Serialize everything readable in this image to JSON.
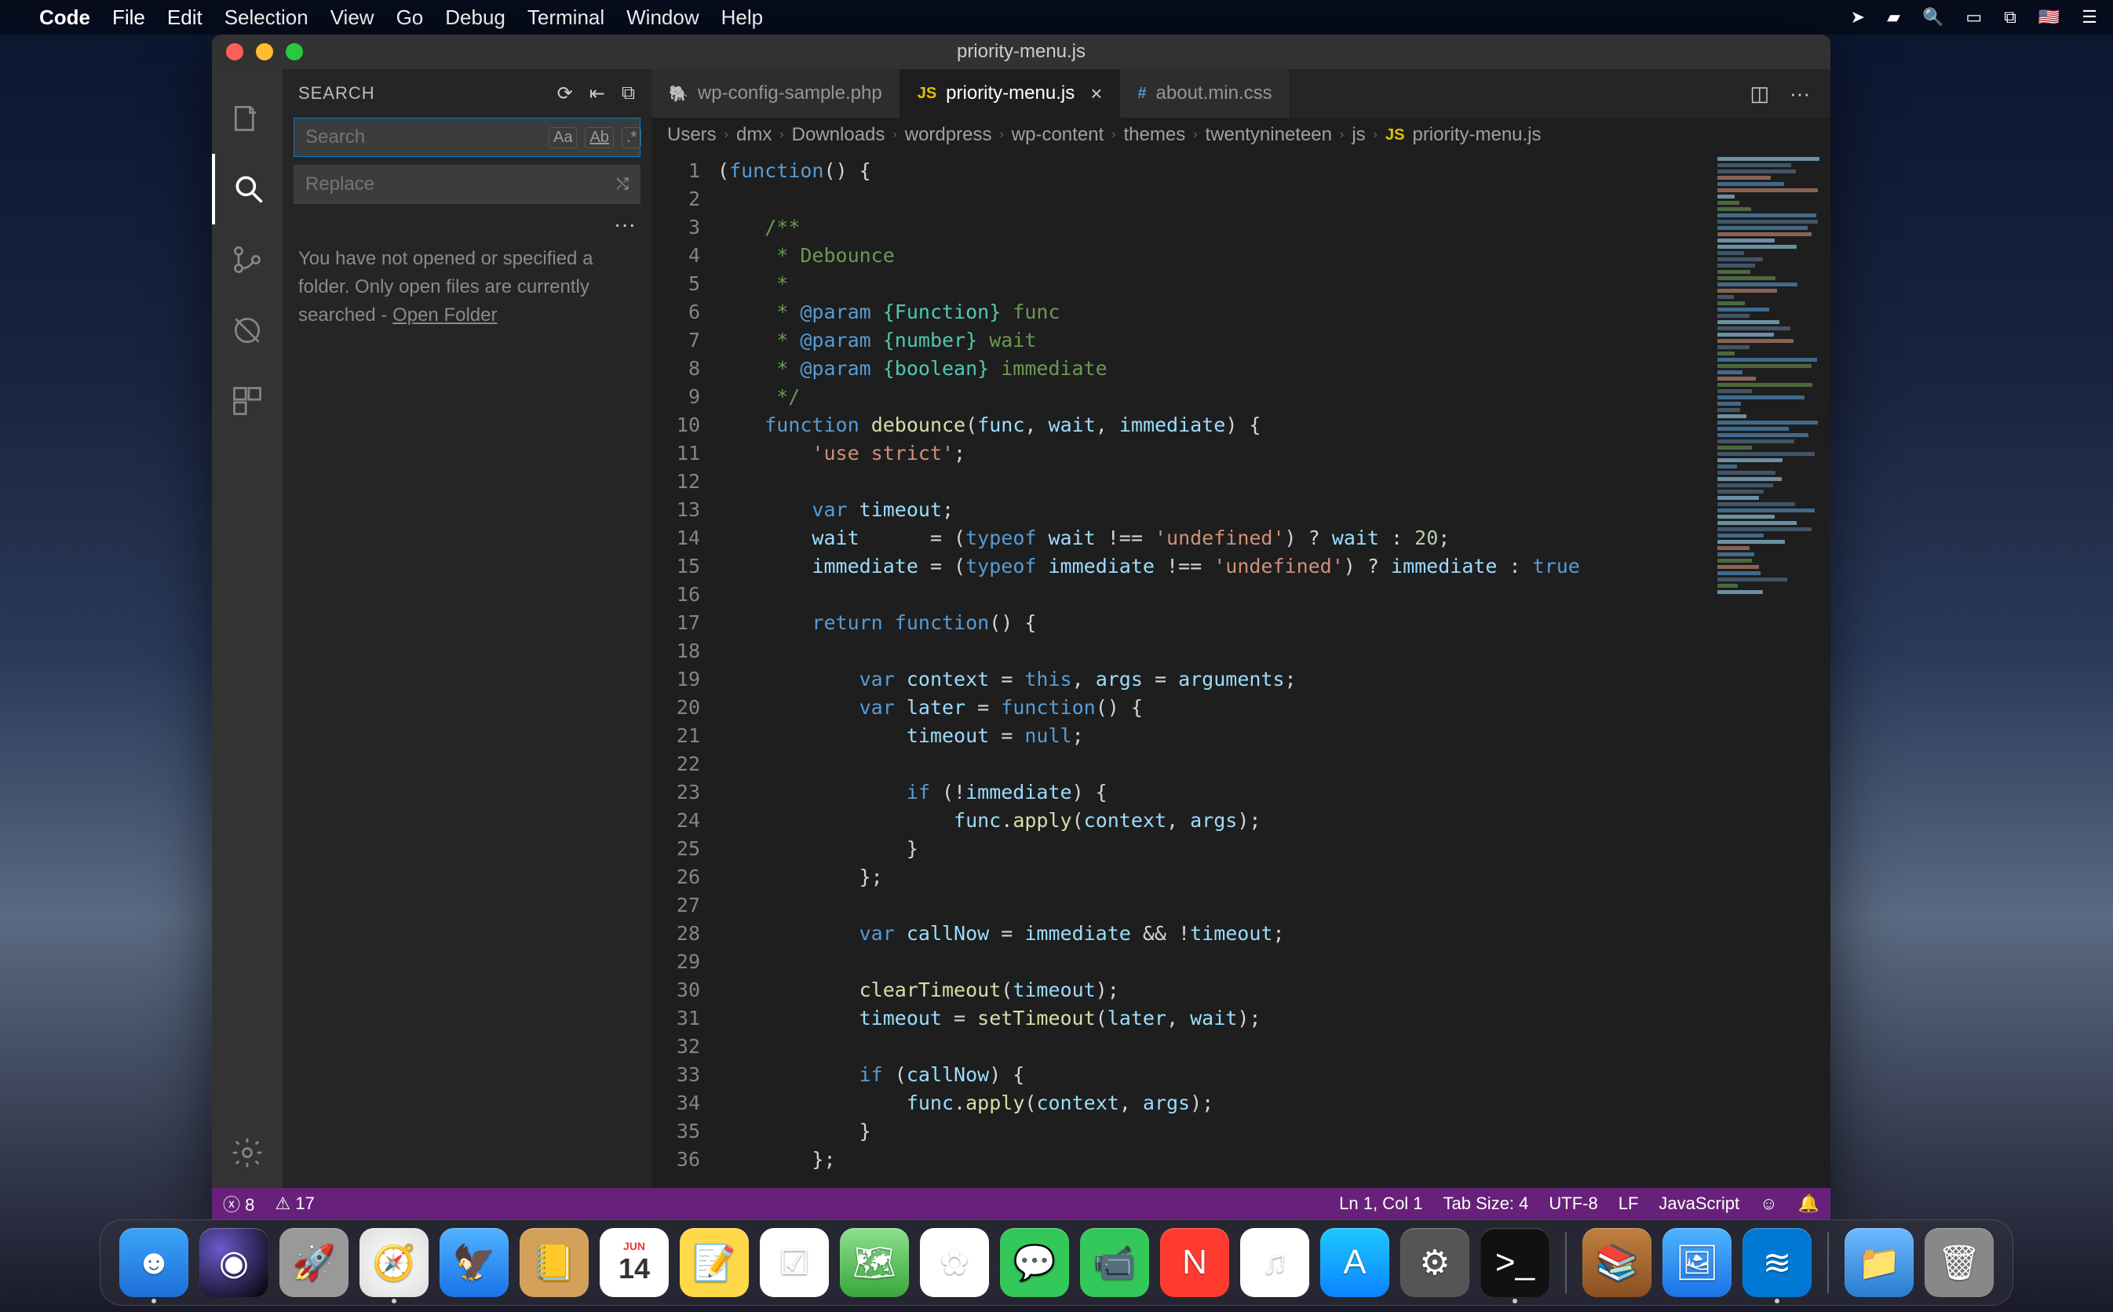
{
  "menubar": {
    "app": "Code",
    "items": [
      "File",
      "Edit",
      "Selection",
      "View",
      "Go",
      "Debug",
      "Terminal",
      "Window",
      "Help"
    ]
  },
  "window": {
    "title": "priority-menu.js"
  },
  "sidebar": {
    "title": "SEARCH",
    "search_placeholder": "Search",
    "replace_placeholder": "Replace",
    "message_1": "You have not opened or specified a folder. Only open files are currently searched - ",
    "open_folder": "Open Folder"
  },
  "tabs": [
    {
      "label": "wp-config-sample.php",
      "icon": "php",
      "active": false
    },
    {
      "label": "priority-menu.js",
      "icon": "js",
      "active": true,
      "closeable": true
    },
    {
      "label": "about.min.css",
      "icon": "css",
      "active": false
    }
  ],
  "breadcrumbs": [
    "Users",
    "dmx",
    "Downloads",
    "wordpress",
    "wp-content",
    "themes",
    "twentynineteen",
    "js",
    "priority-menu.js"
  ],
  "code_lines": 36,
  "code_tokens": [
    [
      [
        "punc",
        "("
      ],
      [
        "keyword",
        "function"
      ],
      [
        "punc",
        "() {"
      ]
    ],
    [],
    [
      [
        "comment",
        "    /**"
      ]
    ],
    [
      [
        "comment",
        "     * Debounce"
      ]
    ],
    [
      [
        "comment",
        "     *"
      ]
    ],
    [
      [
        "comment",
        "     * "
      ],
      [
        "doctag",
        "@param"
      ],
      [
        "comment",
        " "
      ],
      [
        "doctype",
        "{Function}"
      ],
      [
        "comment",
        " func"
      ]
    ],
    [
      [
        "comment",
        "     * "
      ],
      [
        "doctag",
        "@param"
      ],
      [
        "comment",
        " "
      ],
      [
        "doctype",
        "{number}"
      ],
      [
        "comment",
        " wait"
      ]
    ],
    [
      [
        "comment",
        "     * "
      ],
      [
        "doctag",
        "@param"
      ],
      [
        "comment",
        " "
      ],
      [
        "doctype",
        "{boolean}"
      ],
      [
        "comment",
        " immediate"
      ]
    ],
    [
      [
        "comment",
        "     */"
      ]
    ],
    [
      [
        "punc",
        "    "
      ],
      [
        "keyword",
        "function"
      ],
      [
        "punc",
        " "
      ],
      [
        "func",
        "debounce"
      ],
      [
        "punc",
        "("
      ],
      [
        "var",
        "func"
      ],
      [
        "punc",
        ", "
      ],
      [
        "var",
        "wait"
      ],
      [
        "punc",
        ", "
      ],
      [
        "var",
        "immediate"
      ],
      [
        "punc",
        ") {"
      ]
    ],
    [
      [
        "punc",
        "        "
      ],
      [
        "string",
        "'use strict'"
      ],
      [
        "punc",
        ";"
      ]
    ],
    [],
    [
      [
        "punc",
        "        "
      ],
      [
        "keyword",
        "var"
      ],
      [
        "punc",
        " "
      ],
      [
        "var",
        "timeout"
      ],
      [
        "punc",
        ";"
      ]
    ],
    [
      [
        "punc",
        "        "
      ],
      [
        "var",
        "wait"
      ],
      [
        "punc",
        "      = ("
      ],
      [
        "keyword",
        "typeof"
      ],
      [
        "punc",
        " "
      ],
      [
        "var",
        "wait"
      ],
      [
        "punc",
        " !== "
      ],
      [
        "string",
        "'undefined'"
      ],
      [
        "punc",
        ") ? "
      ],
      [
        "var",
        "wait"
      ],
      [
        "punc",
        " : "
      ],
      [
        "number",
        "20"
      ],
      [
        "punc",
        ";"
      ]
    ],
    [
      [
        "punc",
        "        "
      ],
      [
        "var",
        "immediate"
      ],
      [
        "punc",
        " = ("
      ],
      [
        "keyword",
        "typeof"
      ],
      [
        "punc",
        " "
      ],
      [
        "var",
        "immediate"
      ],
      [
        "punc",
        " !== "
      ],
      [
        "string",
        "'undefined'"
      ],
      [
        "punc",
        ") ? "
      ],
      [
        "var",
        "immediate"
      ],
      [
        "punc",
        " : "
      ],
      [
        "const",
        "true"
      ]
    ],
    [],
    [
      [
        "punc",
        "        "
      ],
      [
        "keyword",
        "return"
      ],
      [
        "punc",
        " "
      ],
      [
        "keyword",
        "function"
      ],
      [
        "punc",
        "() {"
      ]
    ],
    [],
    [
      [
        "punc",
        "            "
      ],
      [
        "keyword",
        "var"
      ],
      [
        "punc",
        " "
      ],
      [
        "var",
        "context"
      ],
      [
        "punc",
        " = "
      ],
      [
        "const",
        "this"
      ],
      [
        "punc",
        ", "
      ],
      [
        "var",
        "args"
      ],
      [
        "punc",
        " = "
      ],
      [
        "var",
        "arguments"
      ],
      [
        "punc",
        ";"
      ]
    ],
    [
      [
        "punc",
        "            "
      ],
      [
        "keyword",
        "var"
      ],
      [
        "punc",
        " "
      ],
      [
        "var",
        "later"
      ],
      [
        "punc",
        " = "
      ],
      [
        "keyword",
        "function"
      ],
      [
        "punc",
        "() {"
      ]
    ],
    [
      [
        "punc",
        "                "
      ],
      [
        "var",
        "timeout"
      ],
      [
        "punc",
        " = "
      ],
      [
        "const",
        "null"
      ],
      [
        "punc",
        ";"
      ]
    ],
    [],
    [
      [
        "punc",
        "                "
      ],
      [
        "keyword",
        "if"
      ],
      [
        "punc",
        " (!"
      ],
      [
        "var",
        "immediate"
      ],
      [
        "punc",
        ") {"
      ]
    ],
    [
      [
        "punc",
        "                    "
      ],
      [
        "var",
        "func"
      ],
      [
        "punc",
        "."
      ],
      [
        "func",
        "apply"
      ],
      [
        "punc",
        "("
      ],
      [
        "var",
        "context"
      ],
      [
        "punc",
        ", "
      ],
      [
        "var",
        "args"
      ],
      [
        "punc",
        ");"
      ]
    ],
    [
      [
        "punc",
        "                }"
      ]
    ],
    [
      [
        "punc",
        "            };"
      ]
    ],
    [],
    [
      [
        "punc",
        "            "
      ],
      [
        "keyword",
        "var"
      ],
      [
        "punc",
        " "
      ],
      [
        "var",
        "callNow"
      ],
      [
        "punc",
        " = "
      ],
      [
        "var",
        "immediate"
      ],
      [
        "punc",
        " && !"
      ],
      [
        "var",
        "timeout"
      ],
      [
        "punc",
        ";"
      ]
    ],
    [],
    [
      [
        "punc",
        "            "
      ],
      [
        "func",
        "clearTimeout"
      ],
      [
        "punc",
        "("
      ],
      [
        "var",
        "timeout"
      ],
      [
        "punc",
        ");"
      ]
    ],
    [
      [
        "punc",
        "            "
      ],
      [
        "var",
        "timeout"
      ],
      [
        "punc",
        " = "
      ],
      [
        "func",
        "setTimeout"
      ],
      [
        "punc",
        "("
      ],
      [
        "var",
        "later"
      ],
      [
        "punc",
        ", "
      ],
      [
        "var",
        "wait"
      ],
      [
        "punc",
        ");"
      ]
    ],
    [],
    [
      [
        "punc",
        "            "
      ],
      [
        "keyword",
        "if"
      ],
      [
        "punc",
        " ("
      ],
      [
        "var",
        "callNow"
      ],
      [
        "punc",
        ") {"
      ]
    ],
    [
      [
        "punc",
        "                "
      ],
      [
        "var",
        "func"
      ],
      [
        "punc",
        "."
      ],
      [
        "func",
        "apply"
      ],
      [
        "punc",
        "("
      ],
      [
        "var",
        "context"
      ],
      [
        "punc",
        ", "
      ],
      [
        "var",
        "args"
      ],
      [
        "punc",
        ");"
      ]
    ],
    [
      [
        "punc",
        "            }"
      ]
    ],
    [
      [
        "punc",
        "        };"
      ]
    ]
  ],
  "statusbar": {
    "errors": "8",
    "warnings": "17",
    "ln_col": "Ln 1, Col 1",
    "tab_size": "Tab Size: 4",
    "encoding": "UTF-8",
    "eol": "LF",
    "language": "JavaScript"
  },
  "dock": [
    "finder",
    "siri",
    "launchpad",
    "safari",
    "mail",
    "contacts",
    "calendar",
    "notes",
    "reminders",
    "maps",
    "photos",
    "messages",
    "facetime",
    "news",
    "itunes",
    "appstore",
    "settings",
    "terminal",
    "books",
    "preview",
    "vscode",
    "folder",
    "trash"
  ]
}
